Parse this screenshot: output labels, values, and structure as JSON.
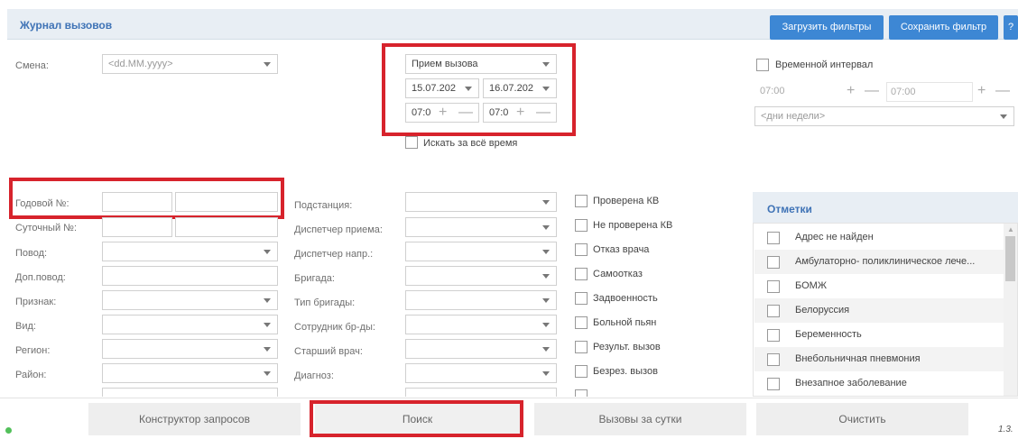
{
  "header": {
    "title": "Журнал вызовов",
    "load_filters": "Загрузить фильтры",
    "save_filter": "Сохранить фильтр",
    "help": "?"
  },
  "shift": {
    "label": "Смена:",
    "placeholder": "<dd.MM.yyyy>"
  },
  "call_receive": {
    "type": "Прием вызова",
    "date_from": "15.07.202",
    "date_to": "16.07.202",
    "time_from": "07:0",
    "time_to": "07:0",
    "search_all_time": "Искать за всё время"
  },
  "time_interval": {
    "label": "Временной интервал",
    "from": "07:00",
    "to": "07:00",
    "weekdays_placeholder": "<дни недели>"
  },
  "left_fields": [
    "Годовой №:",
    "Суточный №:",
    "Повод:",
    "Доп.повод:",
    "Признак:",
    "Вид:",
    "Регион:",
    "Район:"
  ],
  "mid_fields": [
    "Подстанция:",
    "Диспетчер приема:",
    "Диспетчер напр.:",
    "Бригада:",
    "Тип бригады:",
    "Сотрудник бр-ды:",
    "Старший врач:",
    "Диагноз:"
  ],
  "checks": [
    "Проверена КВ",
    "Не проверена КВ",
    "Отказ врача",
    "Самоотказ",
    "Задвоенность",
    "Больной пьян",
    "Результ. вызов",
    "Безрез. вызов"
  ],
  "marks": {
    "title": "Отметки",
    "items": [
      "Адрес не найден",
      "Амбулаторно- поликлиническое лече...",
      "БОМЖ",
      "Белоруссия",
      "Беременность",
      "Внебольничная пневмония",
      "Внезапное заболевание"
    ]
  },
  "buttons": {
    "query_builder": "Конструктор запросов",
    "search": "Поиск",
    "calls_per_day": "Вызовы за сутки",
    "clear": "Очистить"
  },
  "version": "1.3."
}
